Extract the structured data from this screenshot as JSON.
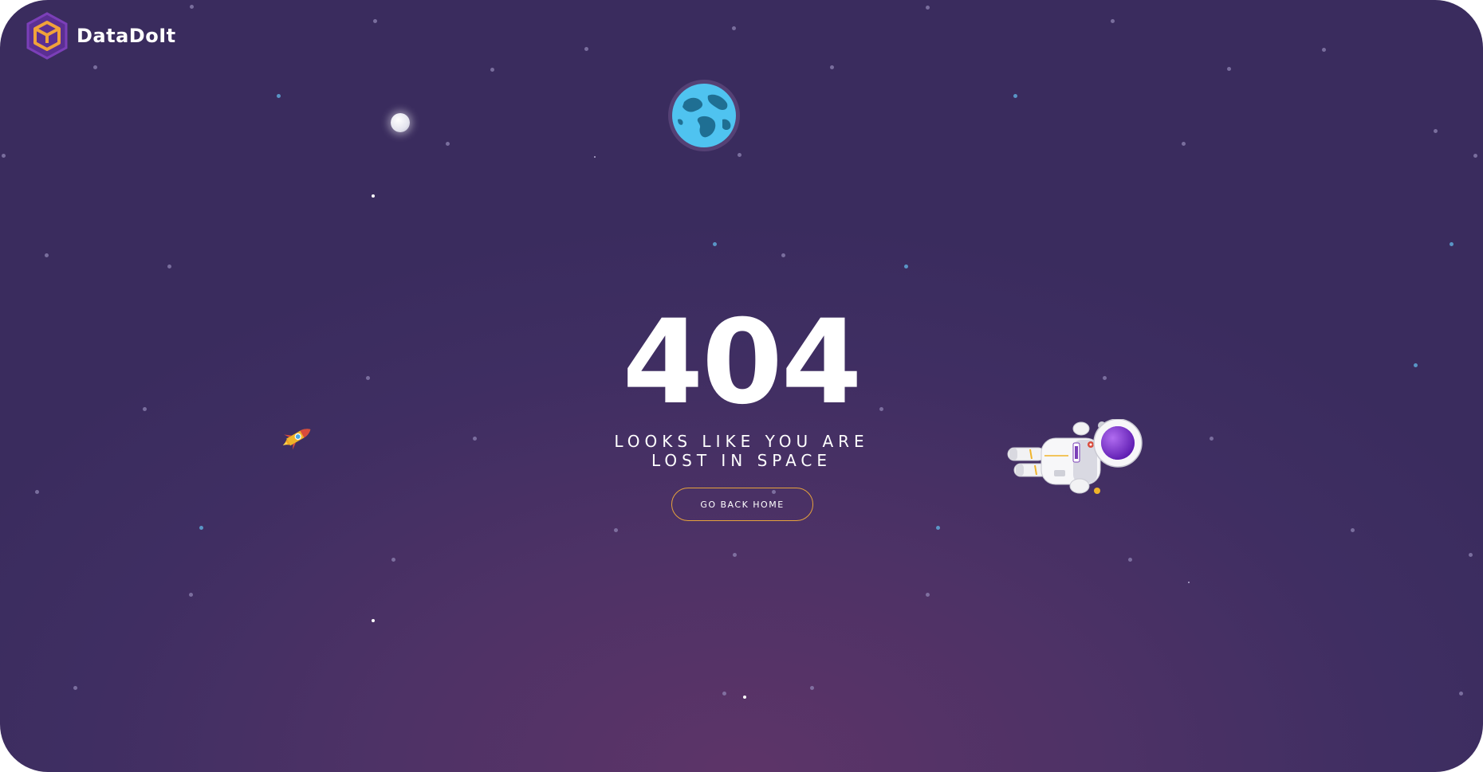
{
  "brand": {
    "name": "DataDoIt",
    "logo_icon": "box-hexagon-icon"
  },
  "error": {
    "code": "404",
    "message_line1": "LOOKS LIKE YOU ARE",
    "message_line2": "LOST IN SPACE"
  },
  "actions": {
    "home_label": "GO BACK HOME"
  },
  "scene": {
    "moon_icon": "moon-icon",
    "earth_icon": "earth-icon",
    "rocket_icon": "rocket-icon",
    "astronaut_icon": "astronaut-icon"
  },
  "colors": {
    "background_top": "#3a2c5e",
    "background_bottom": "#5d3468",
    "button_border": "#e6a23c",
    "logo_orange": "#f0a23a",
    "logo_purple": "#7b3fb8"
  }
}
